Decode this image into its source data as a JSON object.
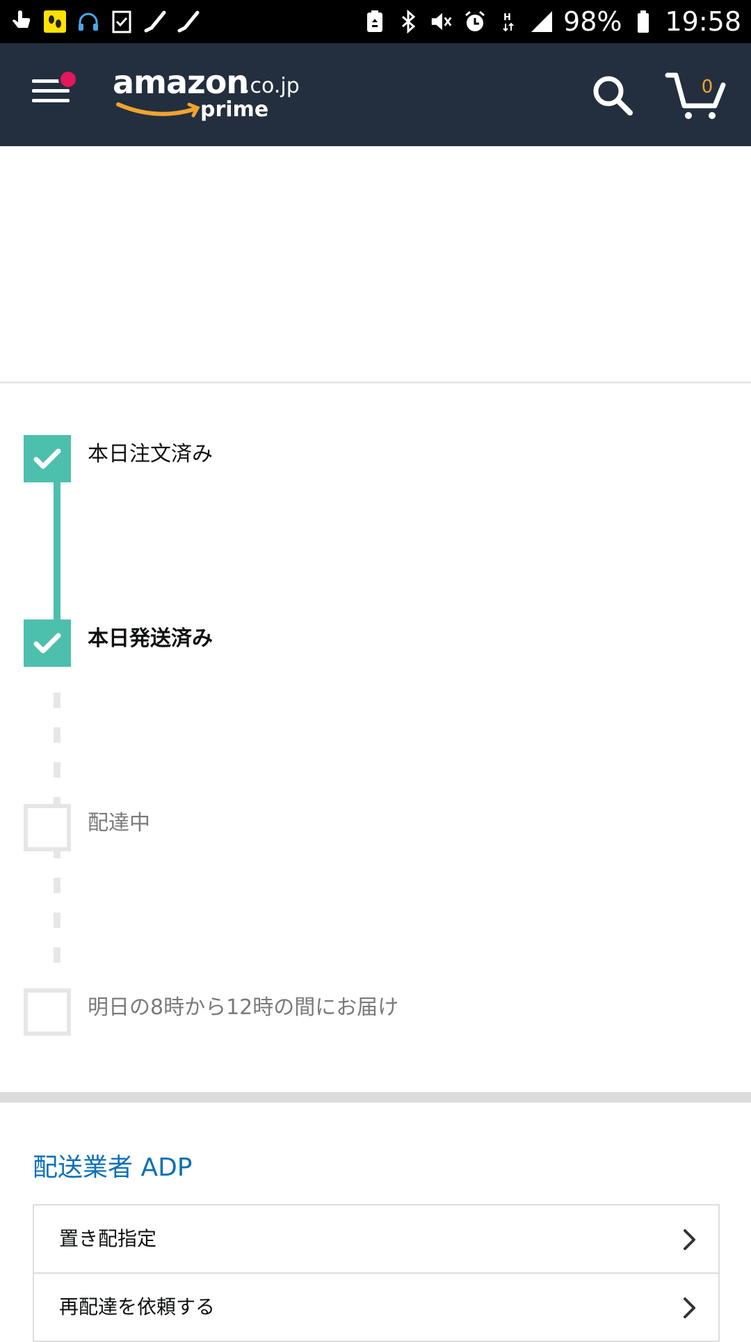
{
  "status_bar": {
    "left_icons": [
      "touch-icon",
      "step-counter-icon",
      "headset-icon",
      "task-check-icon",
      "missed-call-icon",
      "missed-call-icon-2"
    ],
    "right_icons": [
      "battery-saver-icon",
      "bluetooth-icon",
      "mute-icon",
      "alarm-icon",
      "hplus-data-icon",
      "signal-icon"
    ],
    "battery": "98%",
    "time": "19:58"
  },
  "header": {
    "logo_main": "amazon",
    "logo_suffix": ".co.jp",
    "logo_prime": "prime",
    "cart_count": "0",
    "colors": {
      "background": "#232f3e",
      "notification_dot": "#e3175b",
      "cart_count": "#f0a330",
      "smile": "#f0a330"
    }
  },
  "tracking": {
    "colors": {
      "done": "#4dbfad",
      "pending": "#e6e6e6"
    },
    "steps": [
      {
        "label": "本日注文済み",
        "state": "done"
      },
      {
        "label": "本日発送済み",
        "state": "current"
      },
      {
        "label": "配達中",
        "state": "pending"
      },
      {
        "label": "明日の8時から12時の間にお届け",
        "state": "pending"
      }
    ]
  },
  "carrier": {
    "title": "配送業者 ADP",
    "title_color": "#0b70b8",
    "options": [
      {
        "label": "置き配指定"
      },
      {
        "label": "再配達を依頼する"
      }
    ]
  }
}
